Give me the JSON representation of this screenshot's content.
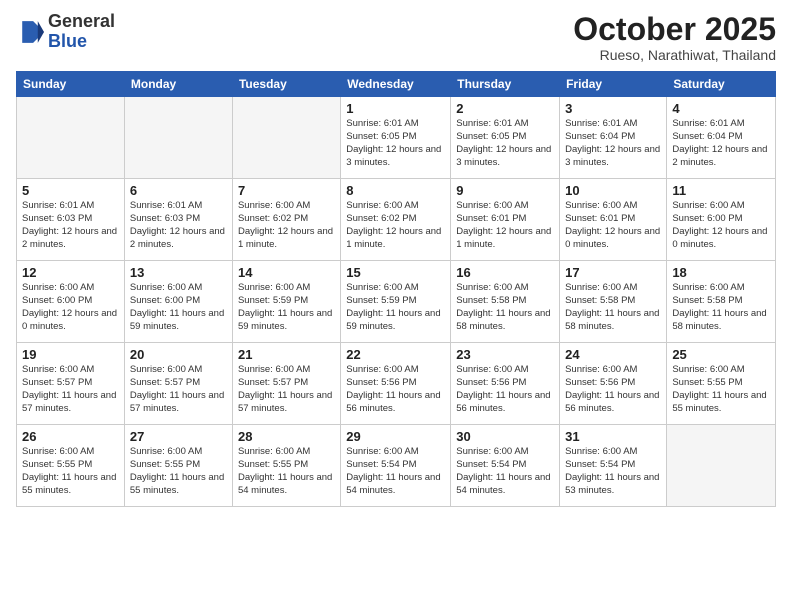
{
  "logo": {
    "general": "General",
    "blue": "Blue"
  },
  "header": {
    "month": "October 2025",
    "location": "Rueso, Narathiwat, Thailand"
  },
  "days_of_week": [
    "Sunday",
    "Monday",
    "Tuesday",
    "Wednesday",
    "Thursday",
    "Friday",
    "Saturday"
  ],
  "weeks": [
    [
      {
        "day": "",
        "info": ""
      },
      {
        "day": "",
        "info": ""
      },
      {
        "day": "",
        "info": ""
      },
      {
        "day": "1",
        "info": "Sunrise: 6:01 AM\nSunset: 6:05 PM\nDaylight: 12 hours\nand 3 minutes."
      },
      {
        "day": "2",
        "info": "Sunrise: 6:01 AM\nSunset: 6:05 PM\nDaylight: 12 hours\nand 3 minutes."
      },
      {
        "day": "3",
        "info": "Sunrise: 6:01 AM\nSunset: 6:04 PM\nDaylight: 12 hours\nand 3 minutes."
      },
      {
        "day": "4",
        "info": "Sunrise: 6:01 AM\nSunset: 6:04 PM\nDaylight: 12 hours\nand 2 minutes."
      }
    ],
    [
      {
        "day": "5",
        "info": "Sunrise: 6:01 AM\nSunset: 6:03 PM\nDaylight: 12 hours\nand 2 minutes."
      },
      {
        "day": "6",
        "info": "Sunrise: 6:01 AM\nSunset: 6:03 PM\nDaylight: 12 hours\nand 2 minutes."
      },
      {
        "day": "7",
        "info": "Sunrise: 6:00 AM\nSunset: 6:02 PM\nDaylight: 12 hours\nand 1 minute."
      },
      {
        "day": "8",
        "info": "Sunrise: 6:00 AM\nSunset: 6:02 PM\nDaylight: 12 hours\nand 1 minute."
      },
      {
        "day": "9",
        "info": "Sunrise: 6:00 AM\nSunset: 6:01 PM\nDaylight: 12 hours\nand 1 minute."
      },
      {
        "day": "10",
        "info": "Sunrise: 6:00 AM\nSunset: 6:01 PM\nDaylight: 12 hours\nand 0 minutes."
      },
      {
        "day": "11",
        "info": "Sunrise: 6:00 AM\nSunset: 6:00 PM\nDaylight: 12 hours\nand 0 minutes."
      }
    ],
    [
      {
        "day": "12",
        "info": "Sunrise: 6:00 AM\nSunset: 6:00 PM\nDaylight: 12 hours\nand 0 minutes."
      },
      {
        "day": "13",
        "info": "Sunrise: 6:00 AM\nSunset: 6:00 PM\nDaylight: 11 hours\nand 59 minutes."
      },
      {
        "day": "14",
        "info": "Sunrise: 6:00 AM\nSunset: 5:59 PM\nDaylight: 11 hours\nand 59 minutes."
      },
      {
        "day": "15",
        "info": "Sunrise: 6:00 AM\nSunset: 5:59 PM\nDaylight: 11 hours\nand 59 minutes."
      },
      {
        "day": "16",
        "info": "Sunrise: 6:00 AM\nSunset: 5:58 PM\nDaylight: 11 hours\nand 58 minutes."
      },
      {
        "day": "17",
        "info": "Sunrise: 6:00 AM\nSunset: 5:58 PM\nDaylight: 11 hours\nand 58 minutes."
      },
      {
        "day": "18",
        "info": "Sunrise: 6:00 AM\nSunset: 5:58 PM\nDaylight: 11 hours\nand 58 minutes."
      }
    ],
    [
      {
        "day": "19",
        "info": "Sunrise: 6:00 AM\nSunset: 5:57 PM\nDaylight: 11 hours\nand 57 minutes."
      },
      {
        "day": "20",
        "info": "Sunrise: 6:00 AM\nSunset: 5:57 PM\nDaylight: 11 hours\nand 57 minutes."
      },
      {
        "day": "21",
        "info": "Sunrise: 6:00 AM\nSunset: 5:57 PM\nDaylight: 11 hours\nand 57 minutes."
      },
      {
        "day": "22",
        "info": "Sunrise: 6:00 AM\nSunset: 5:56 PM\nDaylight: 11 hours\nand 56 minutes."
      },
      {
        "day": "23",
        "info": "Sunrise: 6:00 AM\nSunset: 5:56 PM\nDaylight: 11 hours\nand 56 minutes."
      },
      {
        "day": "24",
        "info": "Sunrise: 6:00 AM\nSunset: 5:56 PM\nDaylight: 11 hours\nand 56 minutes."
      },
      {
        "day": "25",
        "info": "Sunrise: 6:00 AM\nSunset: 5:55 PM\nDaylight: 11 hours\nand 55 minutes."
      }
    ],
    [
      {
        "day": "26",
        "info": "Sunrise: 6:00 AM\nSunset: 5:55 PM\nDaylight: 11 hours\nand 55 minutes."
      },
      {
        "day": "27",
        "info": "Sunrise: 6:00 AM\nSunset: 5:55 PM\nDaylight: 11 hours\nand 55 minutes."
      },
      {
        "day": "28",
        "info": "Sunrise: 6:00 AM\nSunset: 5:55 PM\nDaylight: 11 hours\nand 54 minutes."
      },
      {
        "day": "29",
        "info": "Sunrise: 6:00 AM\nSunset: 5:54 PM\nDaylight: 11 hours\nand 54 minutes."
      },
      {
        "day": "30",
        "info": "Sunrise: 6:00 AM\nSunset: 5:54 PM\nDaylight: 11 hours\nand 54 minutes."
      },
      {
        "day": "31",
        "info": "Sunrise: 6:00 AM\nSunset: 5:54 PM\nDaylight: 11 hours\nand 53 minutes."
      },
      {
        "day": "",
        "info": ""
      }
    ]
  ]
}
